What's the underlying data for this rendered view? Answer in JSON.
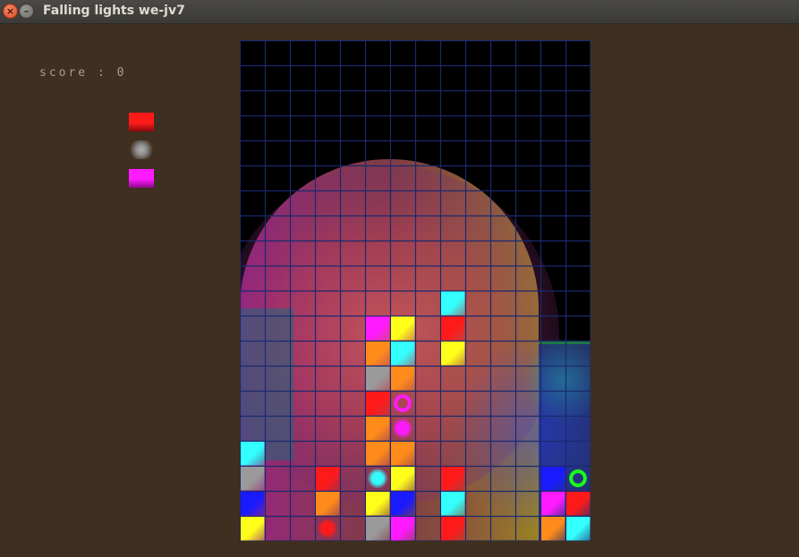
{
  "window": {
    "title": "Falling lights we-jv7",
    "close_glyph": "×",
    "minimize_glyph": "–"
  },
  "hud": {
    "score_label": "score : 0"
  },
  "next_piece": [
    "red-block",
    "gray-orb",
    "magenta-block"
  ],
  "colors": {
    "red": "#ff1a1a",
    "orange": "#ff8c1a",
    "yellow": "#ffff1a",
    "cyan": "#33ffff",
    "blue": "#1a1aff",
    "magenta": "#ff1aff",
    "gray": "#9a9a9a",
    "green": "#1aff1a",
    "grid_line": "#1a2a6e",
    "background": "#3f2f20"
  },
  "board": {
    "cols": 14,
    "rows": 20,
    "cells": [
      {
        "c": 8,
        "r": 10,
        "color": "cyan",
        "shape": "block"
      },
      {
        "c": 5,
        "r": 11,
        "color": "magenta",
        "shape": "block"
      },
      {
        "c": 6,
        "r": 11,
        "color": "yellow",
        "shape": "block"
      },
      {
        "c": 8,
        "r": 11,
        "color": "red",
        "shape": "block"
      },
      {
        "c": 5,
        "r": 12,
        "color": "orange",
        "shape": "block"
      },
      {
        "c": 6,
        "r": 12,
        "color": "cyan",
        "shape": "block"
      },
      {
        "c": 8,
        "r": 12,
        "color": "yellow",
        "shape": "block"
      },
      {
        "c": 5,
        "r": 13,
        "color": "gray",
        "shape": "block"
      },
      {
        "c": 6,
        "r": 13,
        "color": "orange",
        "shape": "block"
      },
      {
        "c": 5,
        "r": 14,
        "color": "red",
        "shape": "block"
      },
      {
        "c": 6,
        "r": 14,
        "color": "magenta",
        "shape": "ring"
      },
      {
        "c": 5,
        "r": 15,
        "color": "orange",
        "shape": "block"
      },
      {
        "c": 6,
        "r": 15,
        "color": "magenta",
        "shape": "orb"
      },
      {
        "c": 0,
        "r": 16,
        "color": "cyan",
        "shape": "block"
      },
      {
        "c": 5,
        "r": 16,
        "color": "orange",
        "shape": "block"
      },
      {
        "c": 6,
        "r": 16,
        "color": "orange",
        "shape": "block"
      },
      {
        "c": 0,
        "r": 17,
        "color": "gray",
        "shape": "block"
      },
      {
        "c": 3,
        "r": 17,
        "color": "red",
        "shape": "block"
      },
      {
        "c": 5,
        "r": 17,
        "color": "cyan",
        "shape": "orb"
      },
      {
        "c": 6,
        "r": 17,
        "color": "yellow",
        "shape": "block"
      },
      {
        "c": 8,
        "r": 17,
        "color": "red",
        "shape": "block"
      },
      {
        "c": 12,
        "r": 17,
        "color": "blue",
        "shape": "block"
      },
      {
        "c": 13,
        "r": 17,
        "color": "green",
        "shape": "ring"
      },
      {
        "c": 0,
        "r": 18,
        "color": "blue",
        "shape": "block"
      },
      {
        "c": 3,
        "r": 18,
        "color": "orange",
        "shape": "block"
      },
      {
        "c": 5,
        "r": 18,
        "color": "yellow",
        "shape": "block"
      },
      {
        "c": 6,
        "r": 18,
        "color": "blue",
        "shape": "block"
      },
      {
        "c": 8,
        "r": 18,
        "color": "cyan",
        "shape": "block"
      },
      {
        "c": 12,
        "r": 18,
        "color": "magenta",
        "shape": "block"
      },
      {
        "c": 13,
        "r": 18,
        "color": "red",
        "shape": "block"
      },
      {
        "c": 0,
        "r": 19,
        "color": "yellow",
        "shape": "block"
      },
      {
        "c": 3,
        "r": 19,
        "color": "red",
        "shape": "orb"
      },
      {
        "c": 5,
        "r": 19,
        "color": "gray",
        "shape": "block"
      },
      {
        "c": 6,
        "r": 19,
        "color": "magenta",
        "shape": "block"
      },
      {
        "c": 8,
        "r": 19,
        "color": "red",
        "shape": "block"
      },
      {
        "c": 12,
        "r": 19,
        "color": "orange",
        "shape": "block"
      },
      {
        "c": 13,
        "r": 19,
        "color": "cyan",
        "shape": "block"
      }
    ]
  }
}
